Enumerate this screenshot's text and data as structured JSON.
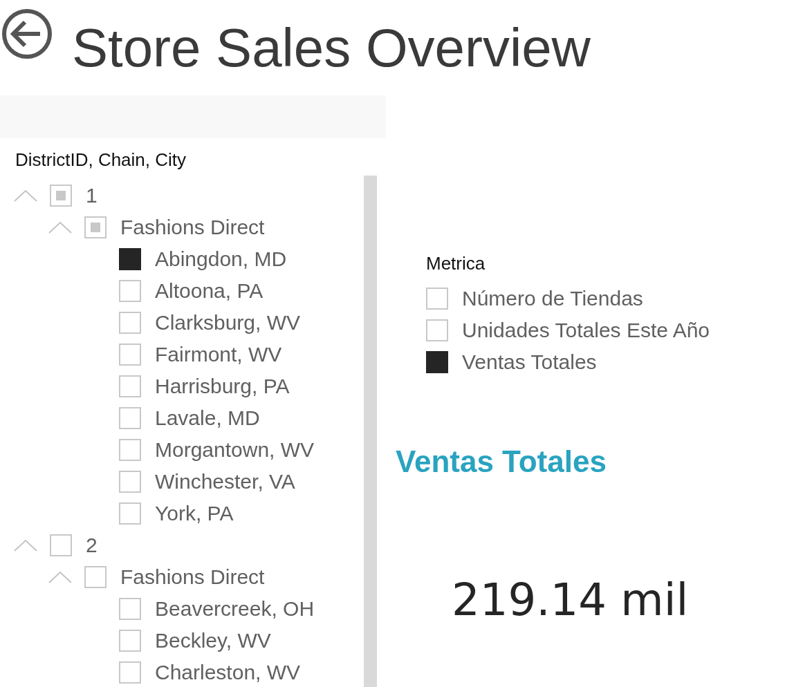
{
  "header": {
    "title": "Store Sales Overview"
  },
  "slicer": {
    "title": "DistrictID, Chain, City",
    "tree": [
      {
        "label": "1",
        "expanded": true,
        "checked": false,
        "partial": true,
        "children": [
          {
            "label": "Fashions Direct",
            "expanded": true,
            "checked": false,
            "partial": true,
            "children": [
              {
                "label": "Abingdon, MD",
                "checked": true
              },
              {
                "label": "Altoona, PA",
                "checked": false
              },
              {
                "label": "Clarksburg, WV",
                "checked": false
              },
              {
                "label": "Fairmont, WV",
                "checked": false
              },
              {
                "label": "Harrisburg, PA",
                "checked": false
              },
              {
                "label": "Lavale, MD",
                "checked": false
              },
              {
                "label": "Morgantown, WV",
                "checked": false
              },
              {
                "label": "Winchester, VA",
                "checked": false
              },
              {
                "label": "York, PA",
                "checked": false
              }
            ]
          }
        ]
      },
      {
        "label": "2",
        "expanded": true,
        "checked": false,
        "partial": false,
        "children": [
          {
            "label": "Fashions Direct",
            "expanded": true,
            "checked": false,
            "partial": false,
            "children": [
              {
                "label": "Beavercreek, OH",
                "checked": false
              },
              {
                "label": "Beckley, WV",
                "checked": false
              },
              {
                "label": "Charleston, WV",
                "checked": false
              }
            ]
          }
        ]
      }
    ]
  },
  "metric_slicer": {
    "title": "Metrica",
    "items": [
      {
        "label": "Número de Tiendas",
        "checked": false
      },
      {
        "label": "Unidades Totales Este Año",
        "checked": false
      },
      {
        "label": "Ventas Totales",
        "checked": true
      }
    ]
  },
  "card": {
    "title": "Ventas Totales",
    "value": "219.14 mil"
  }
}
